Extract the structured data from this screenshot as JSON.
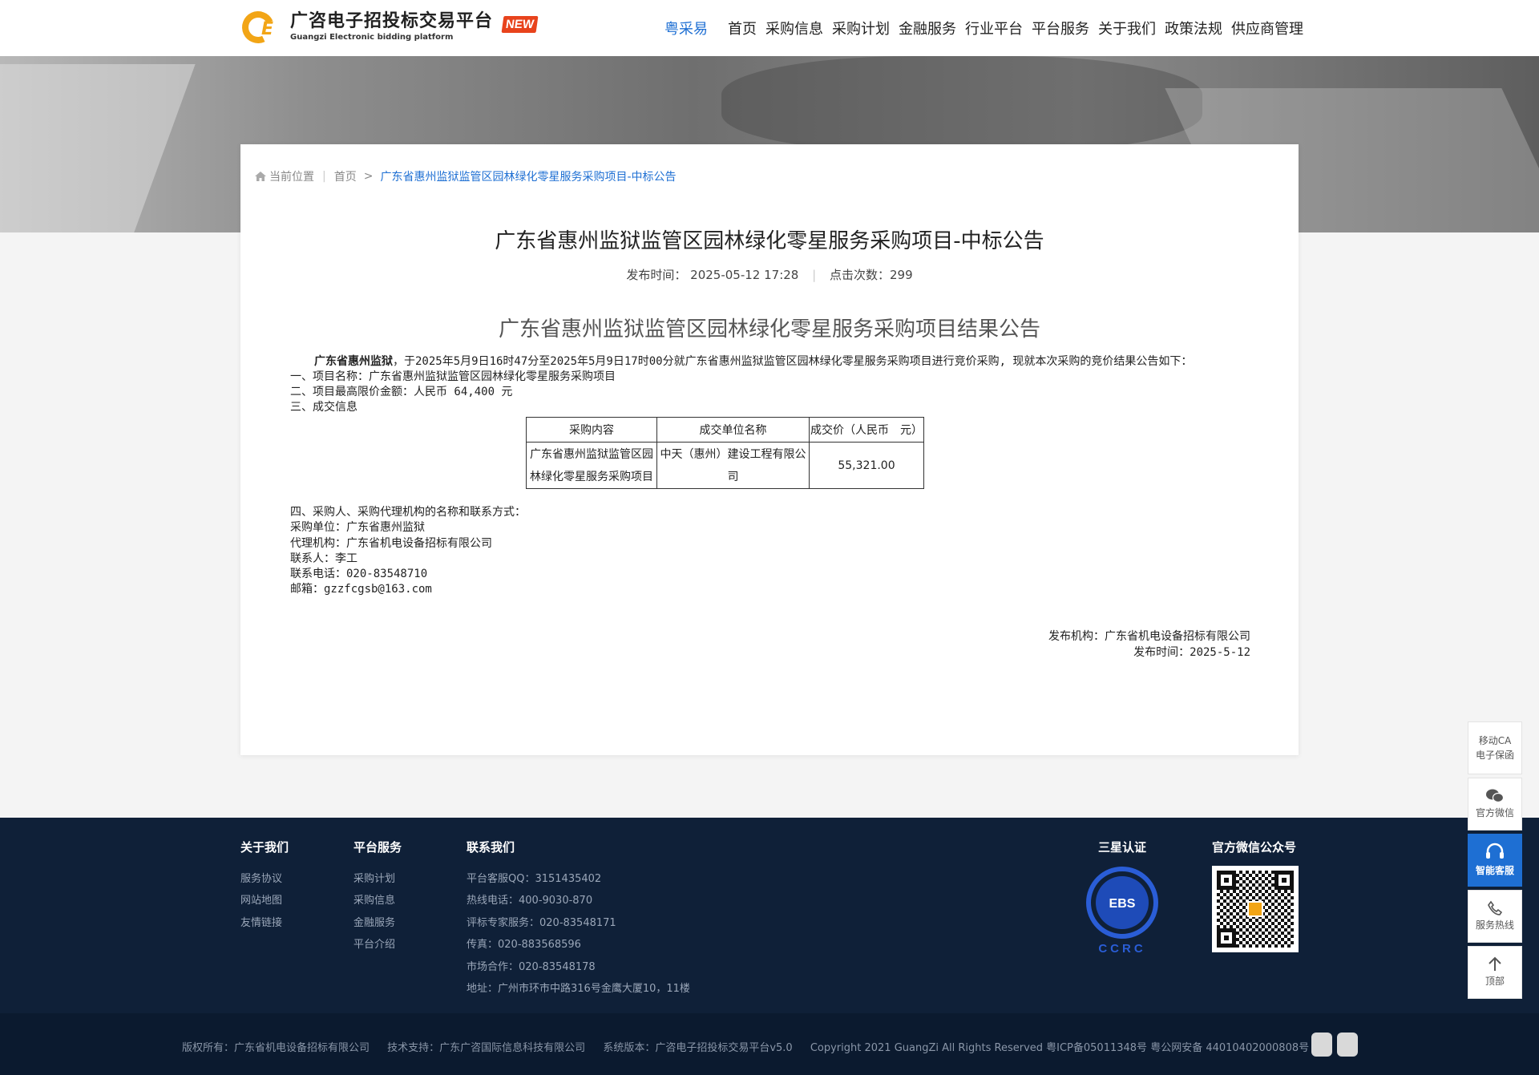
{
  "header": {
    "logo_title": "广咨电子招投标交易平台",
    "logo_sub": "Guangzi Electronic bidding platform",
    "new_badge": "NEW",
    "nav": [
      "粤采易",
      "首页",
      "采购信息",
      "采购计划",
      "金融服务",
      "行业平台",
      "平台服务",
      "关于我们",
      "政策法规",
      "供应商管理"
    ]
  },
  "breadcrumb": {
    "location_label": "当前位置",
    "home": "首页",
    "arrow": ">",
    "current": "广东省惠州监狱监管区园林绿化零星服务采购项目-中标公告"
  },
  "doc": {
    "title": "广东省惠州监狱监管区园林绿化零星服务采购项目-中标公告",
    "publish_label": "发布时间：",
    "publish_time": "2025-05-12 17:28",
    "clicks_label": "点击次数：",
    "clicks": "299",
    "article_title": "广东省惠州监狱监管区园林绿化零星服务采购项目结果公告",
    "intro_bold": "广东省惠州监狱",
    "intro_rest": "，于2025年5月9日16时47分至2025年5月9日17时00分就广东省惠州监狱监管区园林绿化零星服务采购项目进行竞价采购, 现就本次采购的竞价结果公告如下：",
    "item1": "一、项目名称：广东省惠州监狱监管区园林绿化零星服务采购项目",
    "item2": "二、项目最高限价金额：人民币 64,400 元",
    "item3": "三、成交信息",
    "table": {
      "headers": [
        "采购内容",
        "成交单位名称",
        "成交价（人民币　元）"
      ],
      "row": [
        "广东省惠州监狱监管区园林绿化零星服务采购项目",
        "中天（惠州）建设工程有限公司",
        "55,321.00"
      ]
    },
    "item4": "四、采购人、采购代理机构的名称和联系方式：",
    "buyer": "采购单位：广东省惠州监狱",
    "agency": "代理机构：广东省机电设备招标有限公司",
    "contact": "联系人：李工",
    "phone": "联系电话：020-83548710",
    "email": "邮箱：gzzfcgsb@163.com",
    "signoff_org": "发布机构：广东省机电设备招标有限公司",
    "signoff_date": "发布时间：2025-5-12"
  },
  "footer": {
    "about_title": "关于我们",
    "about_links": [
      "服务协议",
      "网站地图",
      "友情链接"
    ],
    "service_title": "平台服务",
    "service_links": [
      "采购计划",
      "采购信息",
      "金融服务",
      "平台介绍"
    ],
    "contact_title": "联系我们",
    "contact_lines": [
      "平台客服QQ：3151435402",
      "热线电话：400-9030-870",
      "评标专家服务：020-83548171",
      "传真：020-883568596",
      "市场合作：020-83548178",
      "地址：广州市环市中路316号金鹰大厦10，11楼"
    ],
    "cert_title": "三星认证",
    "cert_ebs": "EBS",
    "cert_ccrc": "CCRC",
    "wechat_title": "官方微信公众号",
    "copyright": [
      "版权所有：广东省机电设备招标有限公司",
      "技术支持：广东广咨国际信息科技有限公司",
      "系统版本：广咨电子招投标交易平台v5.0",
      "Copyright 2021 GuangZi All Rights Reserved 粤ICP备05011348号 粤公网安备 44010402000808号"
    ]
  },
  "side_tools": {
    "ca_line1": "移动CA",
    "ca_line2": "电子保函",
    "wechat": "官方微信",
    "service": "智能客服",
    "hotline": "服务热线",
    "top": "顶部"
  }
}
